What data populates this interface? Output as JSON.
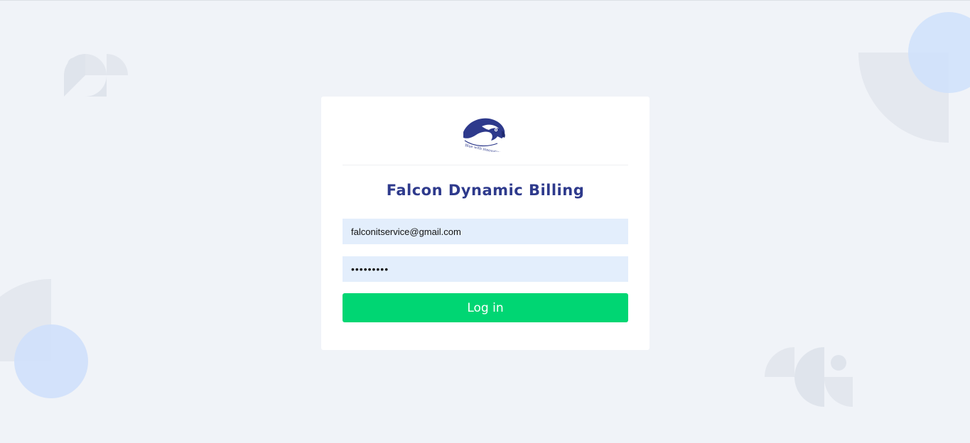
{
  "app": {
    "title": "Falcon Dynamic Billing",
    "logo_icon": "falcon-head-logo",
    "logo_tagline": "Blue with innovation"
  },
  "login_form": {
    "email_value": "falconitservice@gmail.com",
    "password_masked": "•••••••••",
    "submit_label": "Log in"
  },
  "colors": {
    "background": "#f0f3f8",
    "card": "#ffffff",
    "title": "#2e3a8c",
    "input_bg": "#e3eefc",
    "button": "#00d673",
    "decor_gray": "#e2e6ee",
    "decor_blue": "#cfe0fb"
  }
}
